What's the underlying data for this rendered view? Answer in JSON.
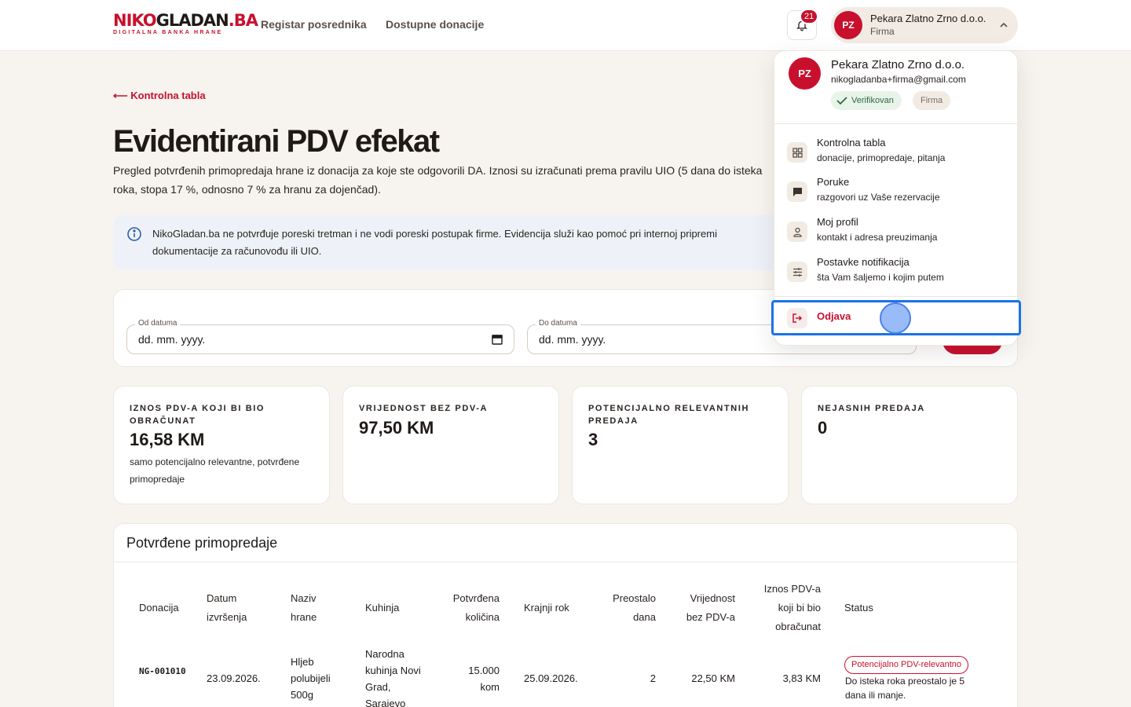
{
  "colors": {
    "brand": "#c8102e",
    "background": "#f7f4ef",
    "focus": "#1a73e8",
    "verified": "#2d6a3e"
  },
  "header": {
    "logo_part1": "NIKO",
    "logo_part2": "GLADAN",
    "logo_part3": ".BA",
    "logo_tagline": "DIGITALNA BANKA HRANE",
    "nav": [
      "Registar posrednika",
      "Dostupne donacije"
    ],
    "notifications_count": "21",
    "user_initials": "PZ",
    "user_name": "Pekara Zlatno Zrno d.o.o.",
    "user_role": "Firma"
  },
  "main": {
    "back_link": "⟵ Kontrolna tabla",
    "title": "Evidentirani PDV efekat",
    "description": "Pregled potvrđenih primopredaja hrane iz donacija za koje ste odgovorili DA. Iznosi su izračunati prema pravilu UIO (5 dana do isteka roka, stopa 17 %, odnosno 7 % za hranu za dojenčad).",
    "info": "NikoGladan.ba ne potvrđuje poreski tretman i ne vodi poreski postupak firme. Evidencija služi kao pomoć pri internoj pripremi dokumentacije za računovođu ili UIO.",
    "filters": {
      "from_label": "Od datuma",
      "from_value": "dd. mm. yyyy.",
      "to_label": "Do datuma",
      "to_value": "dd. mm. yyyy."
    },
    "stats": [
      {
        "label": "IZNOS PDV-A KOJI BI BIO OBRAČUNAT",
        "value": "16,58 KM",
        "note": "samo potencijalno relevantne, potvrđene primopredaje"
      },
      {
        "label": "VRIJEDNOST BEZ PDV-A",
        "value": "97,50 KM"
      },
      {
        "label": "POTENCIJALNO RELEVANTNIH PREDAJA",
        "value": "3"
      },
      {
        "label": "NEJASNIH PREDAJA",
        "value": "0"
      }
    ],
    "table": {
      "title": "Potvrđene primopredaje",
      "columns": [
        "Donacija",
        "Datum izvršenja",
        "Naziv hrane",
        "Kuhinja",
        "Potvrđena količina",
        "Krajnji rok",
        "Preostalo dana",
        "Vrijednost bez PDV-a",
        "Iznos PDV-a koji bi bio obračunat",
        "Status"
      ],
      "rows": [
        {
          "donation": "NG-001010",
          "date": "23.09.2026.",
          "food": "Hljeb polubijeli 500g",
          "kitchen": "Narodna kuhinja Novi Grad, Sarajevo",
          "qty": "15.000 kom",
          "deadline": "25.09.2026.",
          "days_left": "2",
          "value": "22,50 KM",
          "vat": "3,83 KM",
          "status": "Potencijalno PDV-relevantno",
          "status_note": "Do isteka roka preostalo je 5 dana ili manje."
        }
      ]
    }
  },
  "dropdown": {
    "initials": "PZ",
    "name": "Pekara Zlatno Zrno d.o.o.",
    "email": "nikogladanba+firma@gmail.com",
    "verified": "Verifikovan",
    "role": "Firma",
    "items": [
      {
        "title": "Kontrolna tabla",
        "sub": "donacije, primopredaje, pitanja"
      },
      {
        "title": "Poruke",
        "sub": "razgovori uz Vaše rezervacije"
      },
      {
        "title": "Moj profil",
        "sub": "kontakt i adresa preuzimanja"
      },
      {
        "title": "Postavke notifikacija",
        "sub": "šta Vam šaljemo i kojim putem"
      }
    ],
    "logout": "Odjava"
  }
}
